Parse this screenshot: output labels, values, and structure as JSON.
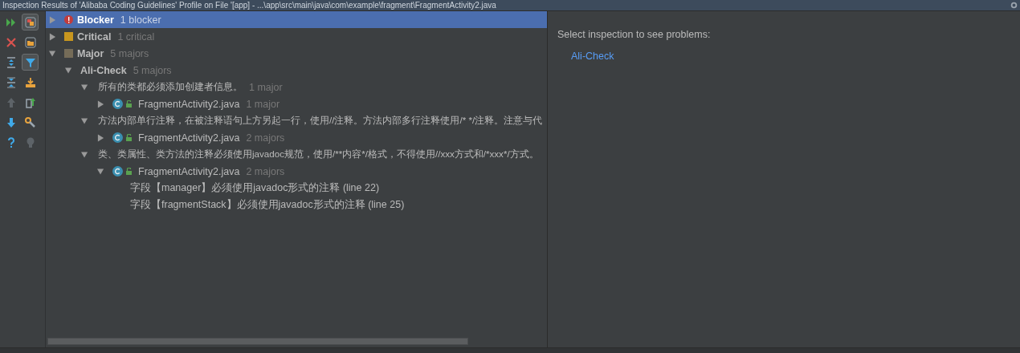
{
  "window": {
    "title": "Inspection Results of 'Alibaba Coding Guidelines' Profile on File '[app] - ...\\app\\src\\main\\java\\com\\example\\fragment\\FragmentActivity2.java"
  },
  "toolbar": [
    [
      {
        "kind": "rerun",
        "on": false,
        "disabled": false
      },
      {
        "kind": "close",
        "on": false,
        "disabled": false
      },
      {
        "kind": "expand-all",
        "on": false,
        "disabled": false
      },
      {
        "kind": "collapse-all",
        "on": false,
        "disabled": false
      },
      {
        "kind": "up",
        "on": false,
        "disabled": true
      },
      {
        "kind": "down",
        "on": false,
        "disabled": false
      },
      {
        "kind": "help",
        "on": false,
        "disabled": false
      }
    ],
    [
      {
        "kind": "group-severity",
        "on": true,
        "disabled": false
      },
      {
        "kind": "group-directory",
        "on": false,
        "disabled": false
      },
      {
        "kind": "filter",
        "on": true,
        "disabled": false
      },
      {
        "kind": "export",
        "on": false,
        "disabled": false
      },
      {
        "kind": "open-file",
        "on": false,
        "disabled": false
      },
      {
        "kind": "settings",
        "on": false,
        "disabled": false
      },
      {
        "kind": "bulb",
        "on": false,
        "disabled": true
      }
    ]
  ],
  "tree": [
    {
      "kind": "severity",
      "label": "Blocker",
      "count": "1 blocker",
      "color": "#c23b3b",
      "expanded": false,
      "selected": true
    },
    {
      "kind": "severity",
      "label": "Critical",
      "count": "1 critical",
      "color": "#c8961e",
      "expanded": false,
      "selected": false
    },
    {
      "kind": "severity",
      "label": "Major",
      "count": "5 majors",
      "color": "#756c58",
      "expanded": true,
      "selected": false,
      "children": [
        {
          "kind": "group",
          "label": "Ali-Check",
          "count": "5 majors",
          "expanded": true,
          "selected": false,
          "children": [
            {
              "kind": "rule",
              "label": "所有的类都必须添加创建者信息。",
              "count": "1 major",
              "expanded": true,
              "selected": false,
              "children": [
                {
                  "kind": "file",
                  "label": "FragmentActivity2.java",
                  "count": "1 major",
                  "expanded": false,
                  "selected": false
                }
              ]
            },
            {
              "kind": "rule",
              "label": "方法内部单行注释，在被注释语句上方另起一行，使用//注释。方法内部多行注释使用/* */注释。注意与代",
              "expanded": true,
              "selected": false,
              "children": [
                {
                  "kind": "file",
                  "label": "FragmentActivity2.java",
                  "count": "2 majors",
                  "expanded": false,
                  "selected": false
                }
              ]
            },
            {
              "kind": "rule",
              "label": "类、类属性、类方法的注释必须使用javadoc规范，使用/**内容*/格式，不得使用//xxx方式和/*xxx*/方式。",
              "expanded": true,
              "selected": false,
              "children": [
                {
                  "kind": "file",
                  "label": "FragmentActivity2.java",
                  "count": "2 majors",
                  "expanded": true,
                  "selected": false,
                  "children": [
                    {
                      "kind": "problem",
                      "label": "字段【manager】必须使用javadoc形式的注释 (line 22)",
                      "selected": false
                    },
                    {
                      "kind": "problem",
                      "label": "字段【fragmentStack】必须使用javadoc形式的注释 (line 25)",
                      "selected": false
                    }
                  ]
                }
              ]
            }
          ]
        }
      ]
    }
  ],
  "details": {
    "message": "Select inspection to see problems:",
    "link": "Ali-Check"
  }
}
